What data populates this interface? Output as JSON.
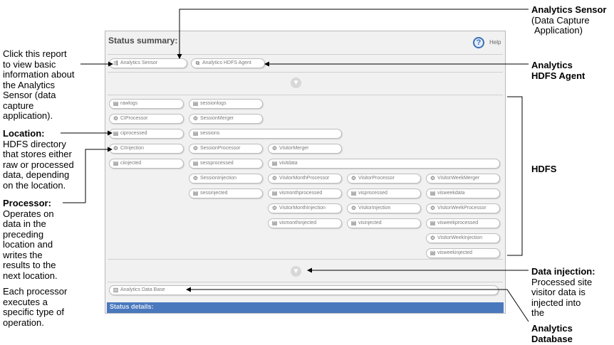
{
  "annotations": {
    "sensor_title": "Analytics Sensor",
    "sensor_sub1": "(Data Capture",
    "sensor_sub2": "Application)",
    "hdfs_agent_line1": "Analytics",
    "hdfs_agent_line2": "HDFS Agent",
    "hdfs": "HDFS",
    "data_injection_title": "Data injection:",
    "data_injection_lines": [
      "Processed site",
      "visitor data is",
      "injected into",
      "the"
    ],
    "db_line1": "Analytics",
    "db_line2": "Database",
    "report_lines": [
      "Click this report",
      "to view basic",
      "information about",
      "the Analytics",
      "Sensor (data",
      "capture",
      "application)."
    ],
    "location_title": "Location:",
    "location_lines": [
      "HDFS directory",
      "that stores either",
      "raw or processed",
      "data, depending",
      "on the location."
    ],
    "processor_title": "Processor:",
    "processor_lines": [
      "Operates on",
      "data in the",
      "preceding",
      "location and",
      "writes the",
      "results to the",
      "next location."
    ],
    "each_lines": [
      "Each processor",
      "executes a",
      "specific type of",
      "operation."
    ]
  },
  "panel": {
    "title": "Status summary:",
    "help_icon": "?",
    "help_label": "Help",
    "status_details": "Status details:"
  },
  "top_nodes": [
    {
      "label": "Analytics Sensor",
      "icon": "sensor-icon"
    },
    {
      "label": "Analytics HDFS Agent",
      "icon": "agent-icon"
    }
  ],
  "hdfs_nodes": [
    {
      "label": "rawlogs",
      "icon": "location-icon"
    },
    {
      "label": "sessionlogs",
      "icon": "location-icon"
    },
    {
      "label": "CIProcessor",
      "icon": "gear-icon"
    },
    {
      "label": "SessionMerger",
      "icon": "gear-icon"
    },
    {
      "label": "ciprocessed",
      "icon": "location-icon"
    },
    {
      "label": "sessions",
      "icon": "location-icon"
    },
    {
      "label": "CIInjection",
      "icon": "gear-icon"
    },
    {
      "label": "SessionProcessor",
      "icon": "gear-icon"
    },
    {
      "label": "VisitorMerger",
      "icon": "gear-icon"
    },
    {
      "label": "ciinjected",
      "icon": "location-icon"
    },
    {
      "label": "sessprocessed",
      "icon": "location-icon"
    },
    {
      "label": "visitdata",
      "icon": "location-icon"
    },
    {
      "label": "SessionInjection",
      "icon": "gear-icon"
    },
    {
      "label": "VisitorMonthProcessor",
      "icon": "gear-icon"
    },
    {
      "label": "VisitorProcessor",
      "icon": "gear-icon"
    },
    {
      "label": "VisitorWeekMerger",
      "icon": "gear-icon"
    },
    {
      "label": "sessinjected",
      "icon": "location-icon"
    },
    {
      "label": "vismonthprocessed",
      "icon": "location-icon"
    },
    {
      "label": "visprocessed",
      "icon": "location-icon"
    },
    {
      "label": "visweekdata",
      "icon": "location-icon"
    },
    {
      "label": "VisitorMonthInjection",
      "icon": "gear-icon"
    },
    {
      "label": "VisitorInjection",
      "icon": "gear-icon"
    },
    {
      "label": "VisitorWeekProcessor",
      "icon": "gear-icon"
    },
    {
      "label": "vismonthinjected",
      "icon": "location-icon"
    },
    {
      "label": "visinjected",
      "icon": "location-icon"
    },
    {
      "label": "visweekprocessed",
      "icon": "location-icon"
    },
    {
      "label": "VisitorWeekInjection",
      "icon": "gear-icon"
    },
    {
      "label": "visweekinjected",
      "icon": "location-icon"
    }
  ],
  "db_node": {
    "label": "Analytics Data Base",
    "icon": "database-icon"
  },
  "colors": {
    "status_bar": "#4a78bd",
    "help": "#3a6fb8",
    "panel": "#f1f1f1"
  }
}
